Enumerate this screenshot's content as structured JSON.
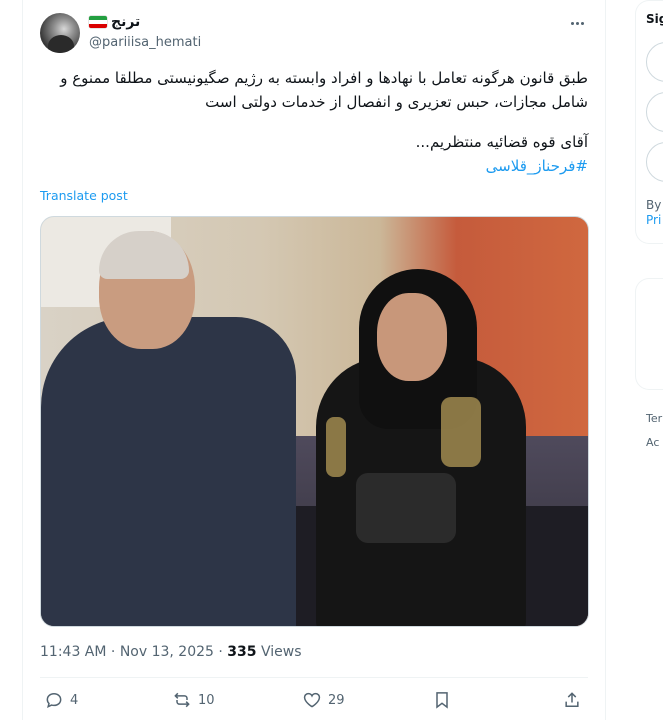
{
  "tweet": {
    "display_name": "ترنج",
    "handle": "@pariiisa_hemati",
    "text_lines": [
      "طبق قانون هرگونه تعامل با نهادها و افراد وابسته به رژیم صگیونیستی مطلقا ممنوع و",
      "شامل مجازات، حبس تعزیری و انفصال از خدمات دولتی است",
      "آقای قوه قضائیه منتظریم..."
    ],
    "hashtag": "#فرحناز_قلاسی",
    "translate_label": "Translate post",
    "time": "11:43 AM",
    "date": "Nov 13, 2025",
    "views_count": "335",
    "views_label": "Views",
    "separator": "·"
  },
  "actions": {
    "replies": "4",
    "reposts": "10",
    "likes": "29"
  },
  "right_column": {
    "signup_fragment": "Sig",
    "by_fragment": "By",
    "privacy_fragment": "Pri",
    "terms_fragment": "Ter",
    "access_fragment": "Ac"
  },
  "icons": [
    "more-icon",
    "reply-icon",
    "repost-icon",
    "like-icon",
    "bookmark-icon",
    "share-icon",
    "flag-icon"
  ],
  "colors": {
    "accent": "#1d9bf0",
    "muted": "#536471",
    "text": "#0f1419",
    "border": "#eff3f4"
  }
}
